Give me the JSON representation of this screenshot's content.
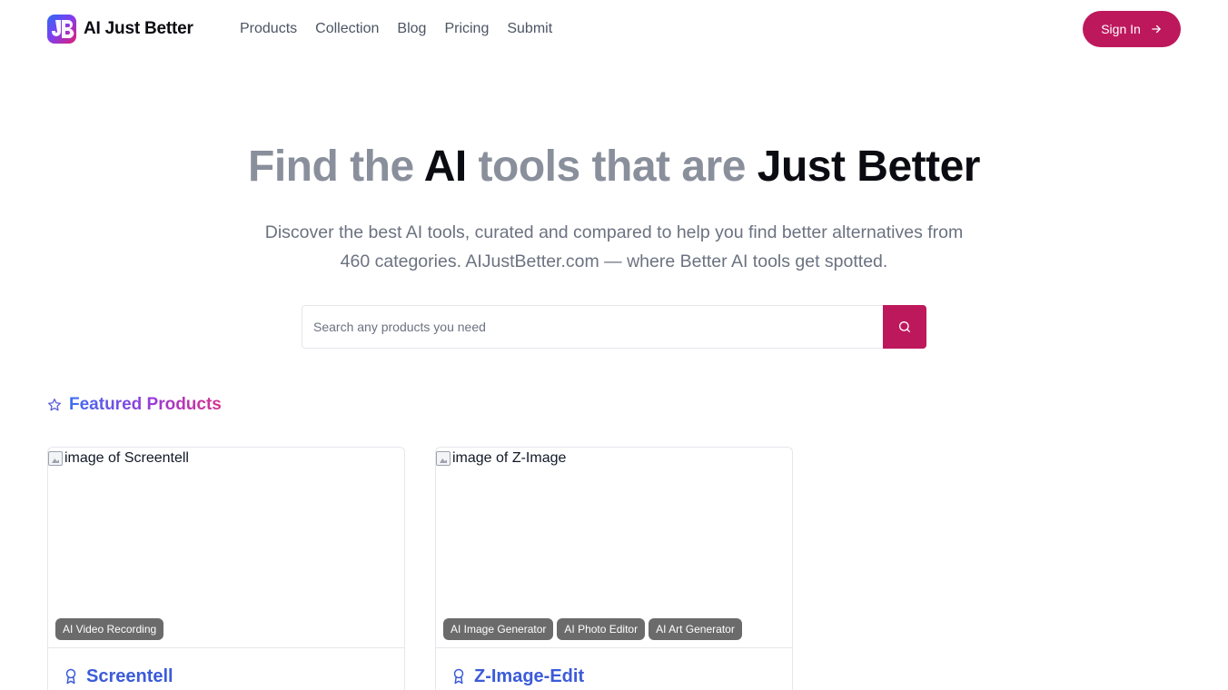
{
  "brand": {
    "name": "AI Just Better",
    "logo_letters": "JB",
    "accent": "#be185d"
  },
  "nav": [
    {
      "label": "Products"
    },
    {
      "label": "Collection"
    },
    {
      "label": "Blog"
    },
    {
      "label": "Pricing"
    },
    {
      "label": "Submit"
    }
  ],
  "header": {
    "signin_label": "Sign In"
  },
  "hero": {
    "title_part1": "Find the ",
    "title_part2": "AI",
    "title_part3": " tools that are ",
    "title_part4": "Just Better",
    "subtitle": "Discover the best AI tools, curated and compared to help you find better alternatives from 460 categories. AIJustBetter.com — where Better AI tools get spotted."
  },
  "search": {
    "placeholder": "Search any products you need",
    "value": ""
  },
  "featured": {
    "heading": "Featured Products",
    "products": [
      {
        "image_alt": "image of Screentell",
        "tags": [
          "AI Video Recording"
        ],
        "name": "Screentell"
      },
      {
        "image_alt": "image of Z-Image",
        "tags": [
          "AI Image Generator",
          "AI Photo Editor",
          "AI Art Generator"
        ],
        "name": "Z-Image-Edit"
      }
    ]
  }
}
